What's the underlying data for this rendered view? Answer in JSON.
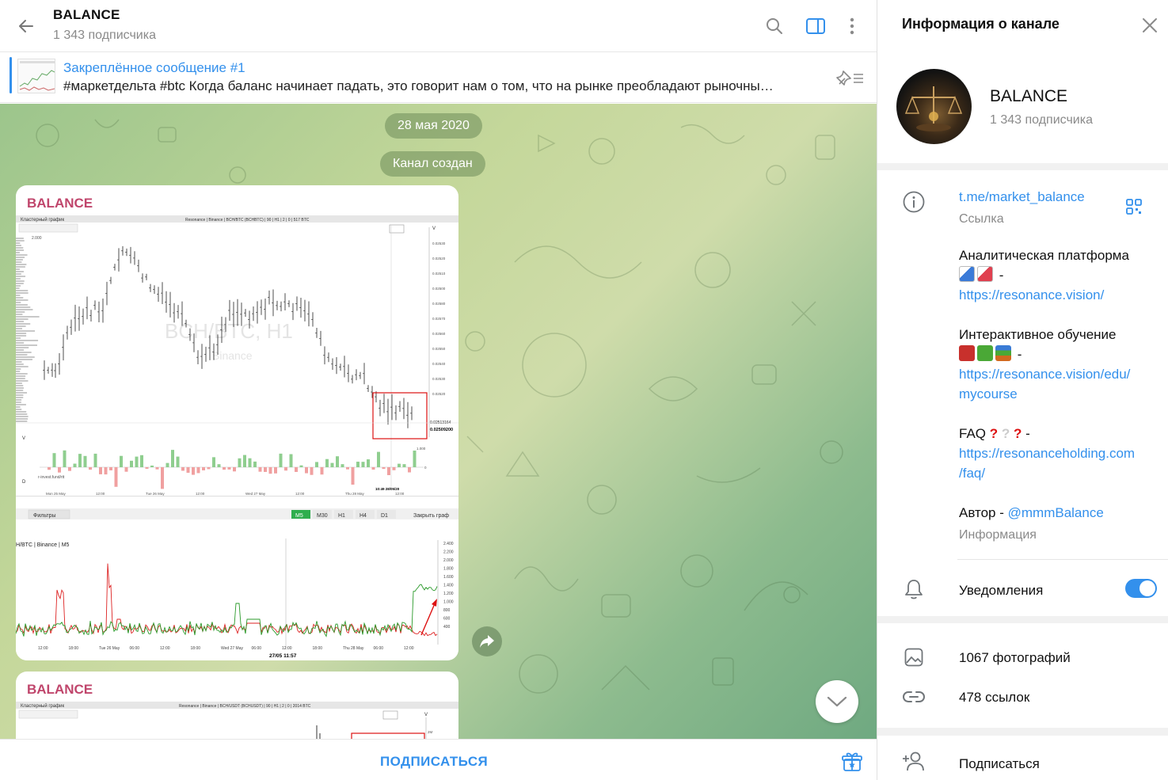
{
  "header": {
    "title": "BALANCE",
    "subscribers": "1 343 подписчика"
  },
  "pinned": {
    "title": "Закреплённое сообщение #1",
    "text": "#маркетдельта #btc    Когда баланс начинает падать, это говорит нам о том, что на рынке преобладают рыночны…"
  },
  "feed": {
    "date_pill": "28 мая 2020",
    "service_pill": "Канал создан",
    "posts": [
      {
        "author": "BALANCE",
        "chart_top": {
          "title_left": "Кластерный график",
          "title_center": "Resonance | Binance | BCH/BTC (BCHBTC) | 90 | H1 | 2 | 0 | 517 BTC",
          "watermark": "BCH/BTC, H1",
          "watermark_sub": "Binance",
          "price_labels": [
            "0.02530",
            "0.02520",
            "0.02510",
            "0.02500",
            "0.02580",
            "0.02570",
            "0.02560",
            "0.02550",
            "0.02540",
            "0.02530",
            "0.02520"
          ],
          "price_current": "0.02513164",
          "price_last": "0.02509200",
          "footer_left": "r-invest.fund/rtt",
          "time_labels": [
            "Mon 25 May",
            "12:00",
            "Tue 26 May",
            "12:00",
            "Wed 27 May",
            "12:00",
            "Thu 28 May",
            "12:00"
          ],
          "cursor_time": "10:49 28/05/20",
          "axis_v": "V",
          "axis_d": "D",
          "vol_label": "1.000",
          "vol_zero": "0",
          "top_value": "2.000"
        },
        "chart_bottom": {
          "filters_label": "Фильтры",
          "timeframes": [
            "M5",
            "M30",
            "H1",
            "H4",
            "D1"
          ],
          "close_label": "Закрыть граф",
          "title": "H/BTC | Binance | M5",
          "y_labels": [
            "2.400",
            "2.200",
            "2.000",
            "1.800",
            "1.600",
            "1.400",
            "1.200",
            "1.000",
            "800",
            "600",
            "400"
          ],
          "x_labels": [
            "12:00",
            "18:00",
            "Tue 26 May",
            "06:00",
            "12:00",
            "18:00",
            "Wed 27 May",
            "06:00",
            "12:00",
            "18:00",
            "Thu 28 May",
            "06:00",
            "12:00"
          ],
          "cursor_label": "27/05 11:57"
        }
      },
      {
        "author": "BALANCE",
        "chart_top": {
          "title_left": "Кластерный график",
          "title_center": "Resonance | Binance | BCH/USDT (BCHUSDT) | 90 | H1 | 2 | 0 | 2014 BTC",
          "axis_v": "V",
          "top_value": "2M"
        }
      }
    ]
  },
  "bottom": {
    "subscribe_label": "ПОДПИСАТЬСЯ"
  },
  "info": {
    "panel_title": "Информация о канале",
    "name": "BALANCE",
    "subscribers": "1 343 подписчика",
    "link": "t.me/market_balance",
    "link_label": "Ссылка",
    "desc": {
      "p1_text": "Аналитическая платформа",
      "p1_link": "https://resonance.vision/",
      "p2_text": "Интерактивное обучение",
      "p2_link_1": "https://resonance.vision/edu/",
      "p2_link_2": "mycourse",
      "p3_text": "FAQ",
      "p3_link_1": "https://resonanceholding.com",
      "p3_link_2": "/faq/",
      "p4_text": "Автор - ",
      "p4_link": "@mmmBalance",
      "dash": "-"
    },
    "desc_label": "Информация",
    "notifications_label": "Уведомления",
    "notifications_on": true,
    "photos": "1067 фотографий",
    "links": "478 ссылок",
    "subscribe": "Подписаться",
    "accent": "#3390ec"
  }
}
